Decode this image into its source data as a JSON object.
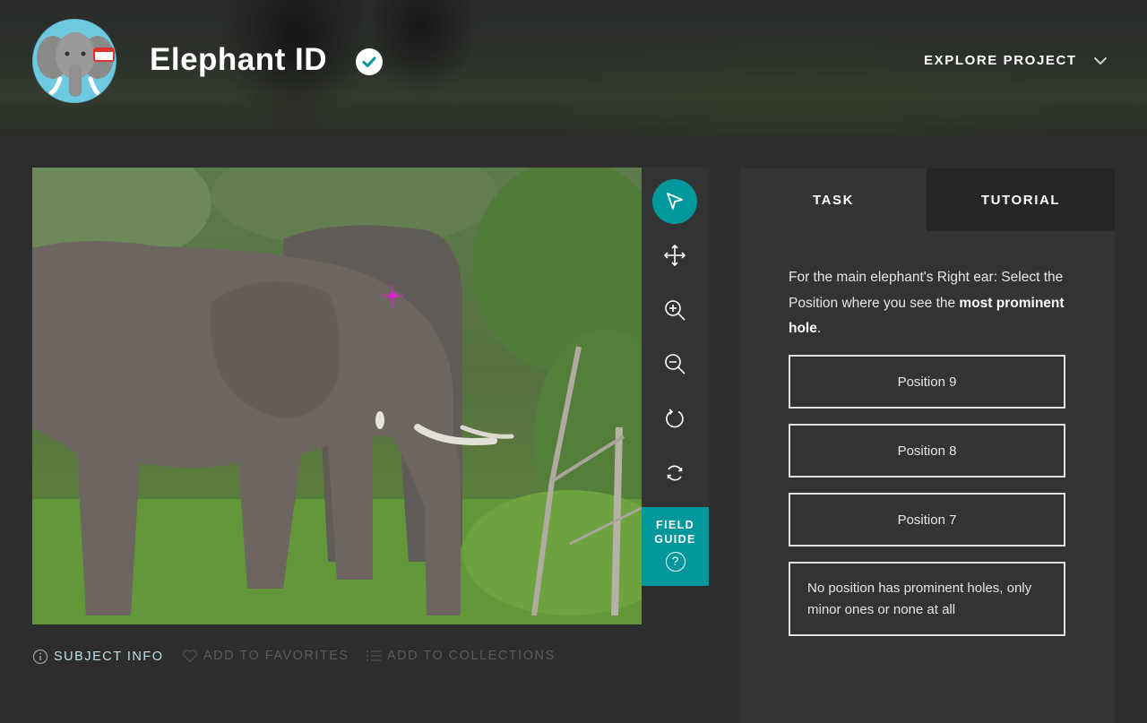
{
  "header": {
    "title": "Elephant ID",
    "explore_label": "EXPLORE PROJECT"
  },
  "toolbar": {
    "tools": [
      "pointer-icon",
      "move-icon",
      "zoom-in-icon",
      "zoom-out-icon",
      "rotate-icon",
      "reset-icon"
    ],
    "field_guide_line1": "FIELD",
    "field_guide_line2": "GUIDE",
    "field_guide_icon": "?"
  },
  "meta": {
    "subject_info": "SUBJECT INFO",
    "add_favorites": "ADD TO FAVORITES",
    "add_collections": "ADD TO COLLECTIONS"
  },
  "panel": {
    "tab_task": "TASK",
    "tab_tutorial": "TUTORIAL",
    "question_part1": "For the main elephant's Right ear: Select the Position where you see the ",
    "question_bold": "most prominent hole",
    "question_end": ".",
    "answers": [
      "Position 9",
      "Position 8",
      "Position 7",
      "No position has prominent holes, only minor ones or none at all"
    ]
  },
  "colors": {
    "accent": "#00979d",
    "background": "#2d2d2d",
    "panel": "#333333",
    "marker": "#e020d0"
  }
}
